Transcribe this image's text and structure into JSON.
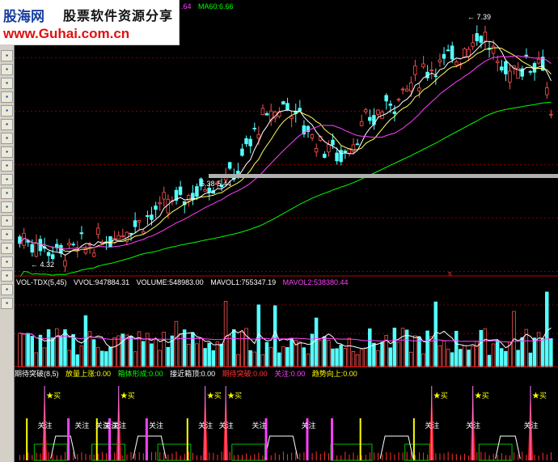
{
  "header": {
    "brand": "股海网",
    "slogan": "股票软件资源分享",
    "url": "www.Guhai.com.cn"
  },
  "price_pane": {
    "ma_legend": [
      {
        "label": ".64",
        "color": "#ff40ff"
      },
      {
        "label": "MA60:6.66",
        "color": "#00ff00"
      }
    ],
    "annotations": {
      "high": "7.39",
      "low": "4.32",
      "mid": "5.38-5.44",
      "marker": "s"
    }
  },
  "volume_pane": {
    "indicator": "VOL-TDX(5,45)",
    "vvol": "VVOL:947884.31",
    "volume": "VOLUME:548983.00",
    "mavol1": "MAVOL1:755347.19",
    "mavol2": "MAVOL2:538380.44"
  },
  "signal_pane": {
    "indicator": "期待突破(8,5)",
    "items": [
      {
        "label": "放量上涨:0.00",
        "color": "#ffff00"
      },
      {
        "label": "箱体形成:0.00",
        "color": "#00ff00"
      },
      {
        "label": "接近箱顶:0.00",
        "color": "#ffffff"
      },
      {
        "label": "期待突破:0.00",
        "color": "#ff3333"
      },
      {
        "label": "关注:0.00",
        "color": "#ff40ff"
      },
      {
        "label": "趋势向上:0.00",
        "color": "#ffff00"
      }
    ],
    "buy_label": "★买",
    "watch_label": "关注"
  },
  "toolbar": {
    "icons": [
      "cursor-icon",
      "grid-icon",
      "list-icon",
      "chart-icon",
      "table-icon",
      "bar-icon",
      "pie-icon",
      "f10-icon",
      "info-icon",
      "rst-icon",
      "tick-icon",
      "line-icon",
      "dollar-icon",
      "pen-icon",
      "arrow-icon",
      "draw-icon",
      "move-icon",
      "up-icon",
      "down-icon"
    ]
  },
  "colors": {
    "up": "#ff5050",
    "down": "#54ffff",
    "ma5": "#ffffff",
    "ma10": "#ffff60",
    "ma20": "#ff40ff",
    "ma60": "#00ff00",
    "grid": "#800000"
  }
}
